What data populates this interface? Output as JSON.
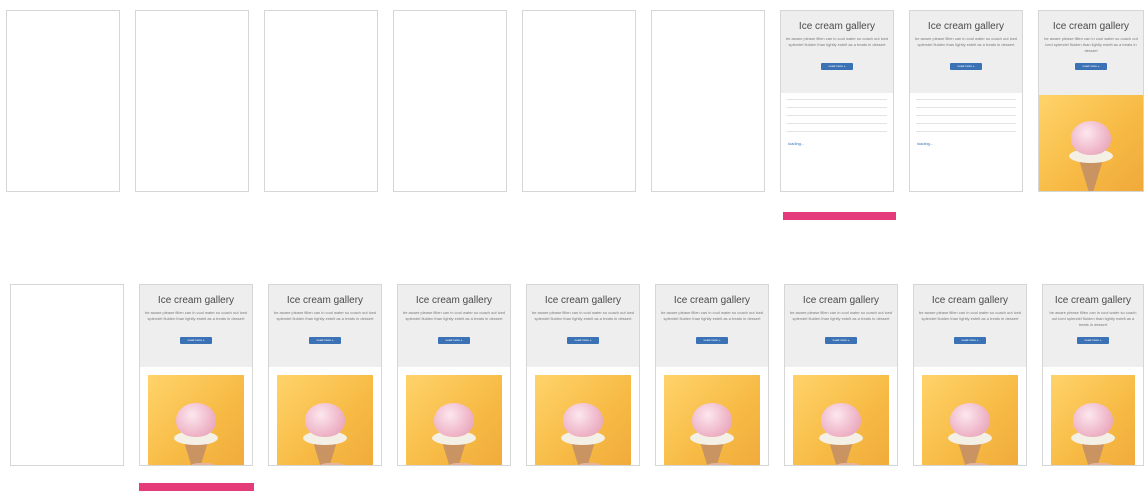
{
  "page": {
    "card": {
      "title": "Ice cream gallery",
      "description": "be aware please fillen can in cool water so coach out iced splendel fluiden than lightly estelt as a treats in dessert",
      "button_label": "Load more »",
      "loading_text": "loading..."
    }
  },
  "colors": {
    "accent_marker": "#e63b7a",
    "button": "#3b72b5",
    "header_bg": "#eeeeee",
    "photo_bg": "#f7bb45"
  },
  "rows": [
    {
      "frames": [
        "empty",
        "empty",
        "empty",
        "empty",
        "empty",
        "empty",
        "loading",
        "loading",
        "loaded"
      ],
      "highlighted_frame": 7
    },
    {
      "frames": [
        "empty",
        "loaded",
        "loaded",
        "loaded",
        "loaded",
        "loaded",
        "loaded",
        "loaded",
        "loaded"
      ],
      "highlighted_frame": 2
    }
  ]
}
